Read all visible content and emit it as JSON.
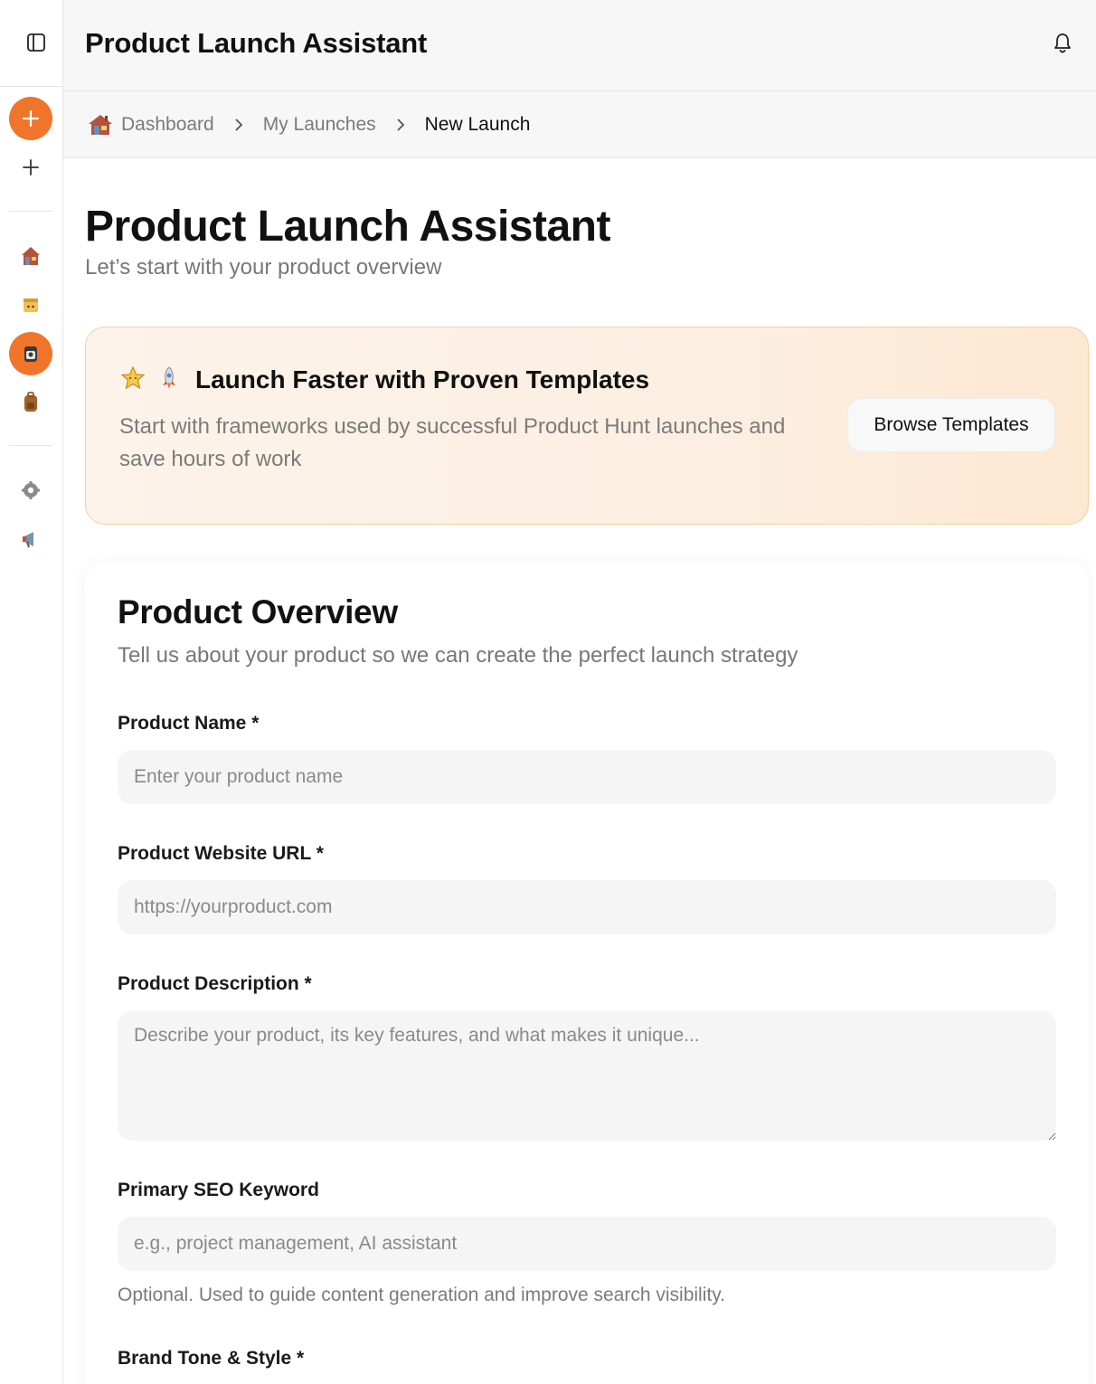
{
  "header": {
    "title": "Product Launch Assistant"
  },
  "breadcrumb": {
    "items": [
      "Dashboard",
      "My Launches",
      "New Launch"
    ]
  },
  "page": {
    "title": "Product Launch Assistant",
    "subtitle": "Let’s start with your product overview"
  },
  "promo": {
    "title": "Launch Faster with Proven Templates",
    "text": "Start with frameworks used by successful Product Hunt launches and save hours of work",
    "button_label": "Browse Templates"
  },
  "form": {
    "title": "Product Overview",
    "subtitle": "Tell us about your product so we can create the perfect launch strategy",
    "fields": [
      {
        "label": "Product Name *",
        "placeholder": "Enter your product name",
        "value": ""
      },
      {
        "label": "Product Website URL *",
        "placeholder": "https://yourproduct.com",
        "value": ""
      },
      {
        "label": "Product Description *",
        "placeholder": "Describe your product, its key features, and what makes it unique...",
        "value": ""
      },
      {
        "label": "Primary SEO Keyword",
        "placeholder": "e.g., project management, AI assistant",
        "value": "",
        "help": "Optional. Used to guide content generation and improve search visibility."
      },
      {
        "label": "Brand Tone & Style *"
      }
    ]
  },
  "sidebar": {
    "icons": [
      "sidebar-toggle-icon",
      "plus-icon",
      "plus-icon",
      "house-icon",
      "folder-icon",
      "camera-icon",
      "backpack-icon",
      "gear-icon",
      "megaphone-icon"
    ]
  },
  "colors": {
    "accent": "#f0752b",
    "promo_border": "#f5cfa3"
  }
}
